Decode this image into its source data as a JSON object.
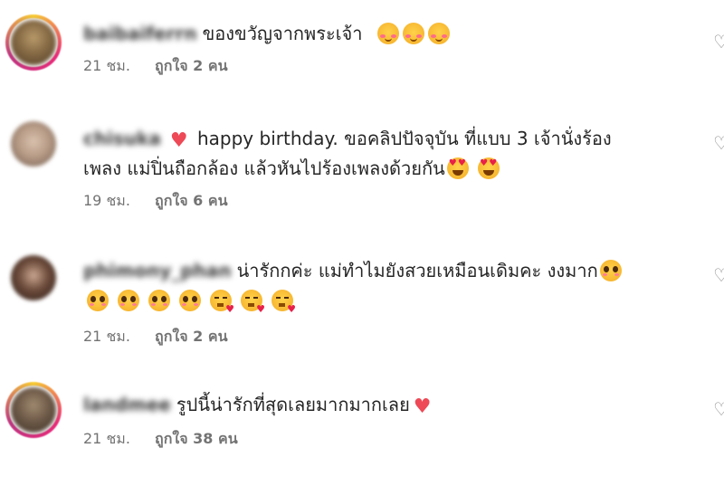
{
  "comments": [
    {
      "username": "baibaiferrn",
      "text_lines": [
        "ของขวัญจากพระเจ้า"
      ],
      "time": "21 ชม.",
      "likes": "ถูกใจ 2 คน",
      "emoji": [
        "smiling-face-with-hearts-emoji",
        "smiling-face-with-hearts-emoji",
        "smiling-face-with-hearts-emoji"
      ]
    },
    {
      "username": "chisuka",
      "text_lines": [
        "happy birthday. ขอคลิปปัจจุบัน ที่แบบ 3 เจ้านั่งร้อง",
        "เพลง แม่ปิ่นถือกล้อง แล้วหันไปร้องเพลงด้วยกัน"
      ],
      "time": "19 ชม.",
      "likes": "ถูกใจ 6 คน",
      "emoji": [
        "heart-emoji",
        "heart-eyes-emoji",
        "heart-eyes-emoji"
      ]
    },
    {
      "username": "phimony_phan",
      "text_lines": [
        "น่ารักกค่ะ แม่ทำไมยังสวยเหมือนเดิมคะ งงมาก"
      ],
      "time": "21 ชม.",
      "likes": "ถูกใจ 2 คน",
      "emoji": [
        "pleading-face-emoji",
        "pleading-face-emoji",
        "pleading-face-emoji",
        "pleading-face-emoji",
        "pleading-face-emoji",
        "face-blowing-kiss-emoji",
        "face-blowing-kiss-emoji",
        "face-blowing-kiss-emoji"
      ]
    },
    {
      "username": "landmee",
      "text_lines": [
        "รูปนี้น่ารักที่สุดเลยมากมากเลย"
      ],
      "time": "21 ชม.",
      "likes": "ถูกใจ 38 คน",
      "emoji": [
        "heart-emoji"
      ]
    }
  ],
  "colors": {
    "text": "#262626",
    "meta": "#737373",
    "heart": "#ed4956",
    "story_ring": [
      "#f9ce34",
      "#ee2a7b",
      "#c13584"
    ]
  }
}
